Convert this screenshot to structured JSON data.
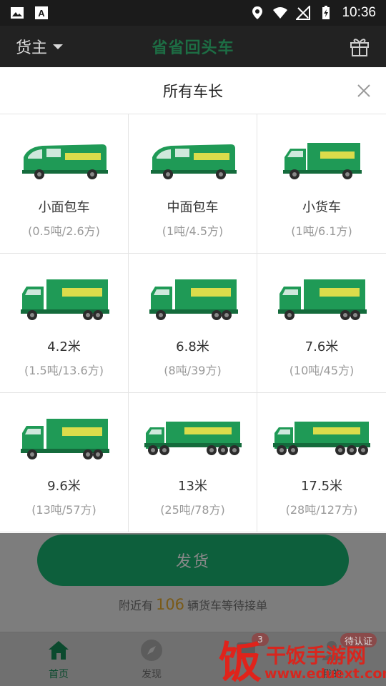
{
  "status_bar": {
    "time": "10:36"
  },
  "header": {
    "role": "货主",
    "brand": "省省回头车"
  },
  "sheet": {
    "title": "所有车长",
    "vehicles": [
      {
        "name": "小面包车",
        "spec": "(0.5吨/2.6方)",
        "kind": "van"
      },
      {
        "name": "中面包车",
        "spec": "(1吨/4.5方)",
        "kind": "van"
      },
      {
        "name": "小货车",
        "spec": "(1吨/6.1方)",
        "kind": "small-truck"
      },
      {
        "name": "4.2米",
        "spec": "(1.5吨/13.6方)",
        "kind": "truck"
      },
      {
        "name": "6.8米",
        "spec": "(8吨/39方)",
        "kind": "truck"
      },
      {
        "name": "7.6米",
        "spec": "(10吨/45方)",
        "kind": "truck"
      },
      {
        "name": "9.6米",
        "spec": "(13吨/57方)",
        "kind": "truck"
      },
      {
        "name": "13米",
        "spec": "(25吨/78方)",
        "kind": "trailer"
      },
      {
        "name": "17.5米",
        "spec": "(28吨/127方)",
        "kind": "trailer"
      }
    ]
  },
  "main": {
    "ship_button": "发货",
    "nearby_prefix": "附近有",
    "nearby_count": "106",
    "nearby_suffix": "辆货车等待接单"
  },
  "tabs": [
    {
      "label": "首页",
      "icon": "home-icon"
    },
    {
      "label": "发现",
      "icon": "compass-icon"
    },
    {
      "label": "",
      "icon": "message-icon",
      "badge": "3"
    },
    {
      "label": "我的",
      "icon": "user-icon",
      "badge": "待认证"
    }
  ],
  "watermark": {
    "text": "干饭手游网",
    "url": "www.eduext.com",
    "glyph": "饭"
  },
  "colors": {
    "accent": "#0d5f3c",
    "truck_green": "#1f9a56",
    "header_bg": "#222222"
  }
}
